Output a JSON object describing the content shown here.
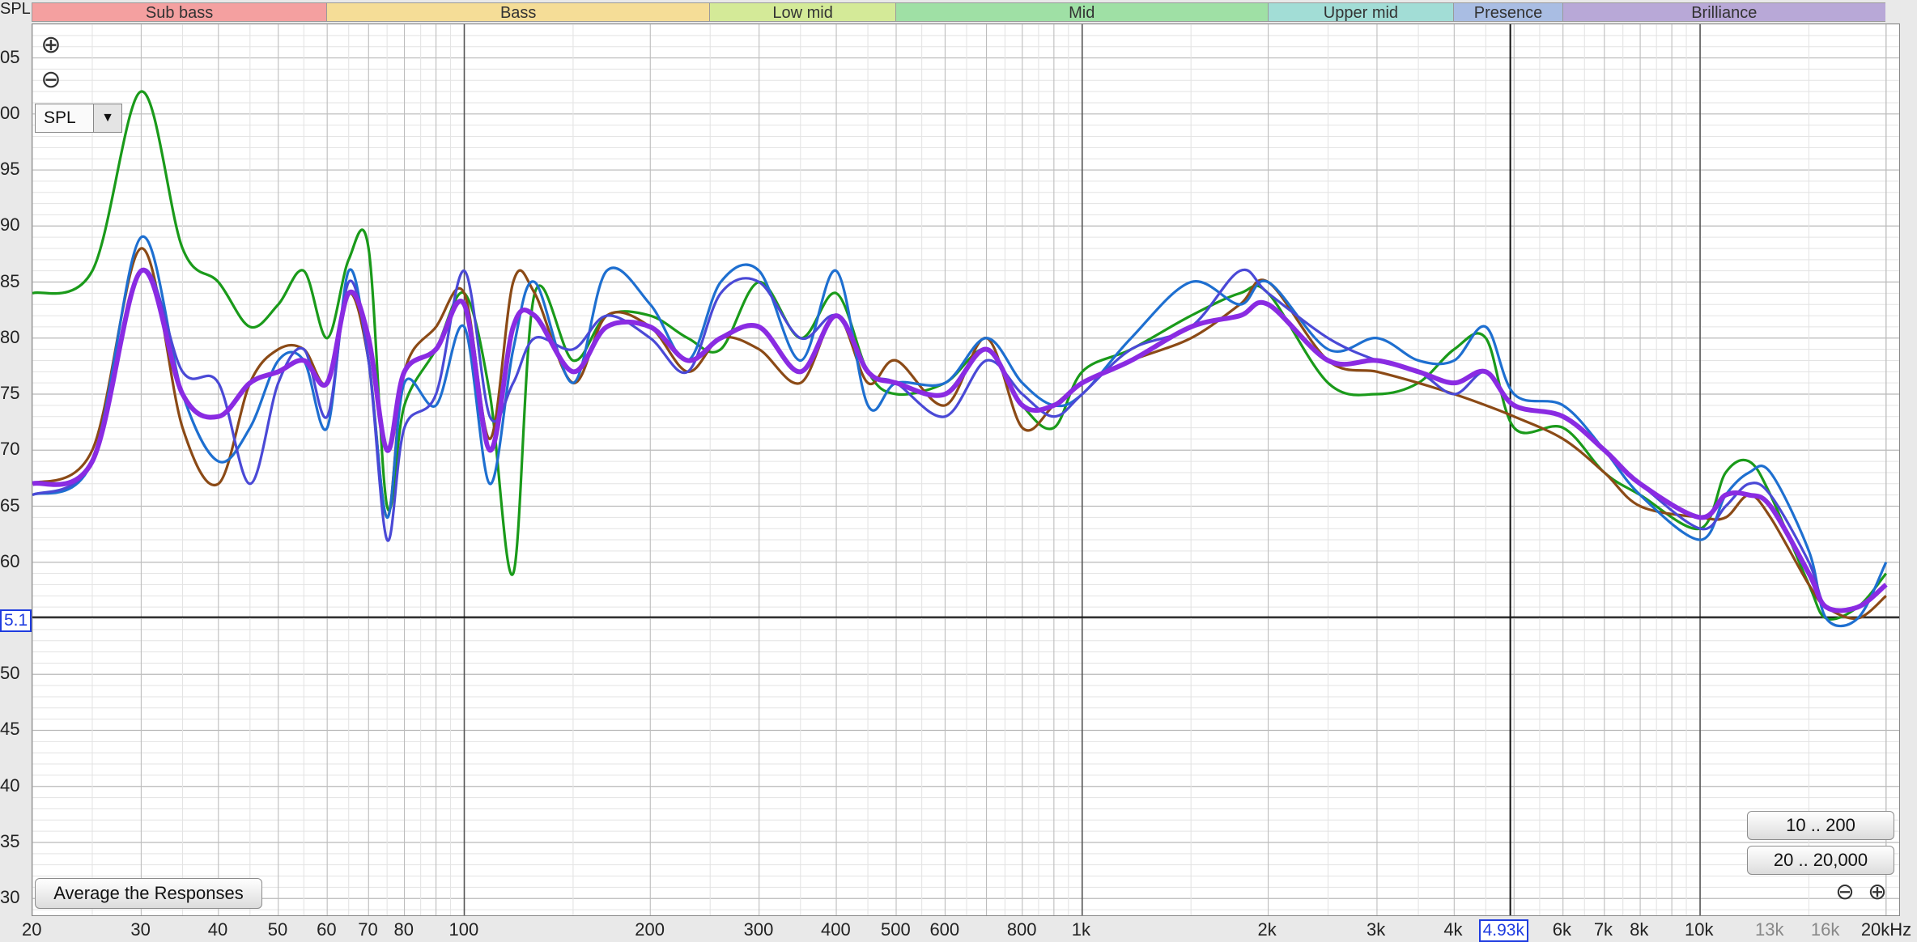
{
  "axis": {
    "y_title": "SPL",
    "y_ticks": [
      "05",
      "00",
      "95",
      "90",
      "85",
      "80",
      "75",
      "70",
      "65",
      "60",
      "55",
      "50",
      "45",
      "40",
      "35",
      "30"
    ],
    "x_ticks": [
      {
        "label": "20",
        "f": 20
      },
      {
        "label": "30",
        "f": 30
      },
      {
        "label": "40",
        "f": 40
      },
      {
        "label": "50",
        "f": 50
      },
      {
        "label": "60",
        "f": 60
      },
      {
        "label": "70",
        "f": 70
      },
      {
        "label": "80",
        "f": 80
      },
      {
        "label": "100",
        "f": 100
      },
      {
        "label": "200",
        "f": 200
      },
      {
        "label": "300",
        "f": 300
      },
      {
        "label": "400",
        "f": 400
      },
      {
        "label": "500",
        "f": 500
      },
      {
        "label": "600",
        "f": 600
      },
      {
        "label": "800",
        "f": 800
      },
      {
        "label": "1k",
        "f": 1000
      },
      {
        "label": "2k",
        "f": 2000
      },
      {
        "label": "3k",
        "f": 3000
      },
      {
        "label": "4k",
        "f": 4000
      },
      {
        "label": "6k",
        "f": 6000
      },
      {
        "label": "7k",
        "f": 7000
      },
      {
        "label": "8k",
        "f": 8000
      },
      {
        "label": "10k",
        "f": 10000
      },
      {
        "label": "13k",
        "f": 13000,
        "grey": true
      },
      {
        "label": "16k",
        "f": 16000,
        "grey": true
      },
      {
        "label": "20kHz",
        "f": 20000
      }
    ]
  },
  "bands": [
    {
      "label": "Sub bass",
      "from": 20,
      "to": 60,
      "color": "#f4a0a0"
    },
    {
      "label": "Bass",
      "from": 60,
      "to": 250,
      "color": "#f5dd97"
    },
    {
      "label": "Low mid",
      "from": 250,
      "to": 500,
      "color": "#d4ea98"
    },
    {
      "label": "Mid",
      "from": 500,
      "to": 2000,
      "color": "#9fe0a5"
    },
    {
      "label": "Upper mid",
      "from": 2000,
      "to": 4000,
      "color": "#a2ddd6"
    },
    {
      "label": "Presence",
      "from": 4000,
      "to": 6000,
      "color": "#a9bde3"
    },
    {
      "label": "Brilliance",
      "from": 6000,
      "to": 20000,
      "color": "#b8a8d7"
    }
  ],
  "cursor": {
    "y_label": "5.1",
    "y_value": 55.1,
    "x_label": "4.93k",
    "x_value": 4930
  },
  "controls": {
    "zoom_in_icon": "⊕",
    "zoom_out_icon": "⊖",
    "spl_select_value": "SPL",
    "range_btn_1": "10 .. 200",
    "range_btn_2": "20 .. 20,000",
    "average_btn": "Average the Responses"
  },
  "chart_data": {
    "type": "line",
    "x_scale": "log",
    "xlim": [
      20,
      21000
    ],
    "ylim": [
      28.5,
      108
    ],
    "grid": true,
    "x": [
      20,
      25,
      30,
      35,
      40,
      45,
      50,
      55,
      60,
      65,
      70,
      75,
      80,
      90,
      100,
      110,
      120,
      130,
      150,
      170,
      200,
      230,
      260,
      300,
      350,
      400,
      450,
      500,
      600,
      700,
      800,
      900,
      1000,
      1200,
      1500,
      1800,
      2000,
      2500,
      3000,
      3500,
      4000,
      4500,
      5000,
      6000,
      7000,
      8000,
      10000,
      11000,
      12000,
      13000,
      15000,
      16000,
      18000,
      20000
    ],
    "series": [
      {
        "color": "#1a9a1a",
        "values": [
          84,
          86,
          102,
          88,
          85,
          81,
          83,
          86,
          80,
          87,
          88,
          65,
          74,
          79,
          84,
          75,
          59,
          84,
          78,
          82,
          82,
          80,
          79,
          85,
          80,
          84,
          77,
          75,
          76,
          79,
          74,
          72,
          77,
          79,
          82,
          84,
          84,
          76,
          75,
          76,
          79,
          80,
          72,
          72,
          68,
          66,
          63,
          68,
          69,
          66,
          58,
          55,
          56,
          59
        ]
      },
      {
        "color": "#8b4a16",
        "values": [
          67,
          70,
          88,
          72,
          67,
          76,
          79,
          79,
          76,
          84,
          78,
          64,
          77,
          81,
          84,
          71,
          85,
          84,
          76,
          82,
          81,
          77,
          80,
          79,
          76,
          82,
          76,
          78,
          74,
          80,
          72,
          74,
          76,
          78,
          80,
          83,
          85,
          78,
          77,
          76,
          75,
          74,
          73,
          71,
          68,
          65,
          64,
          64,
          66,
          64,
          58,
          56,
          55,
          57
        ]
      },
      {
        "color": "#1e6fd0",
        "values": [
          66,
          69,
          89,
          75,
          69,
          72,
          78,
          78,
          72,
          86,
          78,
          64,
          76,
          74,
          81,
          67,
          79,
          85,
          76,
          86,
          83,
          78,
          85,
          86,
          78,
          86,
          74,
          76,
          76,
          80,
          76,
          74,
          75,
          80,
          85,
          83,
          85,
          79,
          80,
          78,
          78,
          81,
          75,
          74,
          70,
          66,
          62,
          66,
          68,
          68,
          61,
          55,
          55,
          60
        ]
      },
      {
        "color": "#4a49d6",
        "values": [
          66,
          69,
          86,
          77,
          76,
          67,
          76,
          79,
          73,
          85,
          78,
          62,
          72,
          75,
          86,
          73,
          76,
          80,
          79,
          82,
          80,
          77,
          84,
          85,
          80,
          82,
          77,
          76,
          73,
          78,
          75,
          73,
          75,
          79,
          81,
          86,
          84,
          80,
          78,
          77,
          75,
          77,
          74,
          73,
          70,
          67,
          63,
          65,
          67,
          66,
          60,
          56,
          56,
          58
        ]
      },
      {
        "color": "#8a2be2",
        "values": [
          67,
          69,
          86,
          75,
          73,
          76,
          77,
          78,
          76,
          84,
          80,
          70,
          77,
          79,
          83,
          70,
          81,
          82,
          77,
          81,
          81,
          78,
          80,
          81,
          77,
          82,
          77,
          76,
          75,
          79,
          74,
          74,
          76,
          78,
          81,
          82,
          83,
          78,
          78,
          77,
          76,
          77,
          74,
          73,
          70,
          67,
          64,
          66,
          66,
          65,
          59,
          56,
          56,
          58
        ]
      }
    ]
  }
}
